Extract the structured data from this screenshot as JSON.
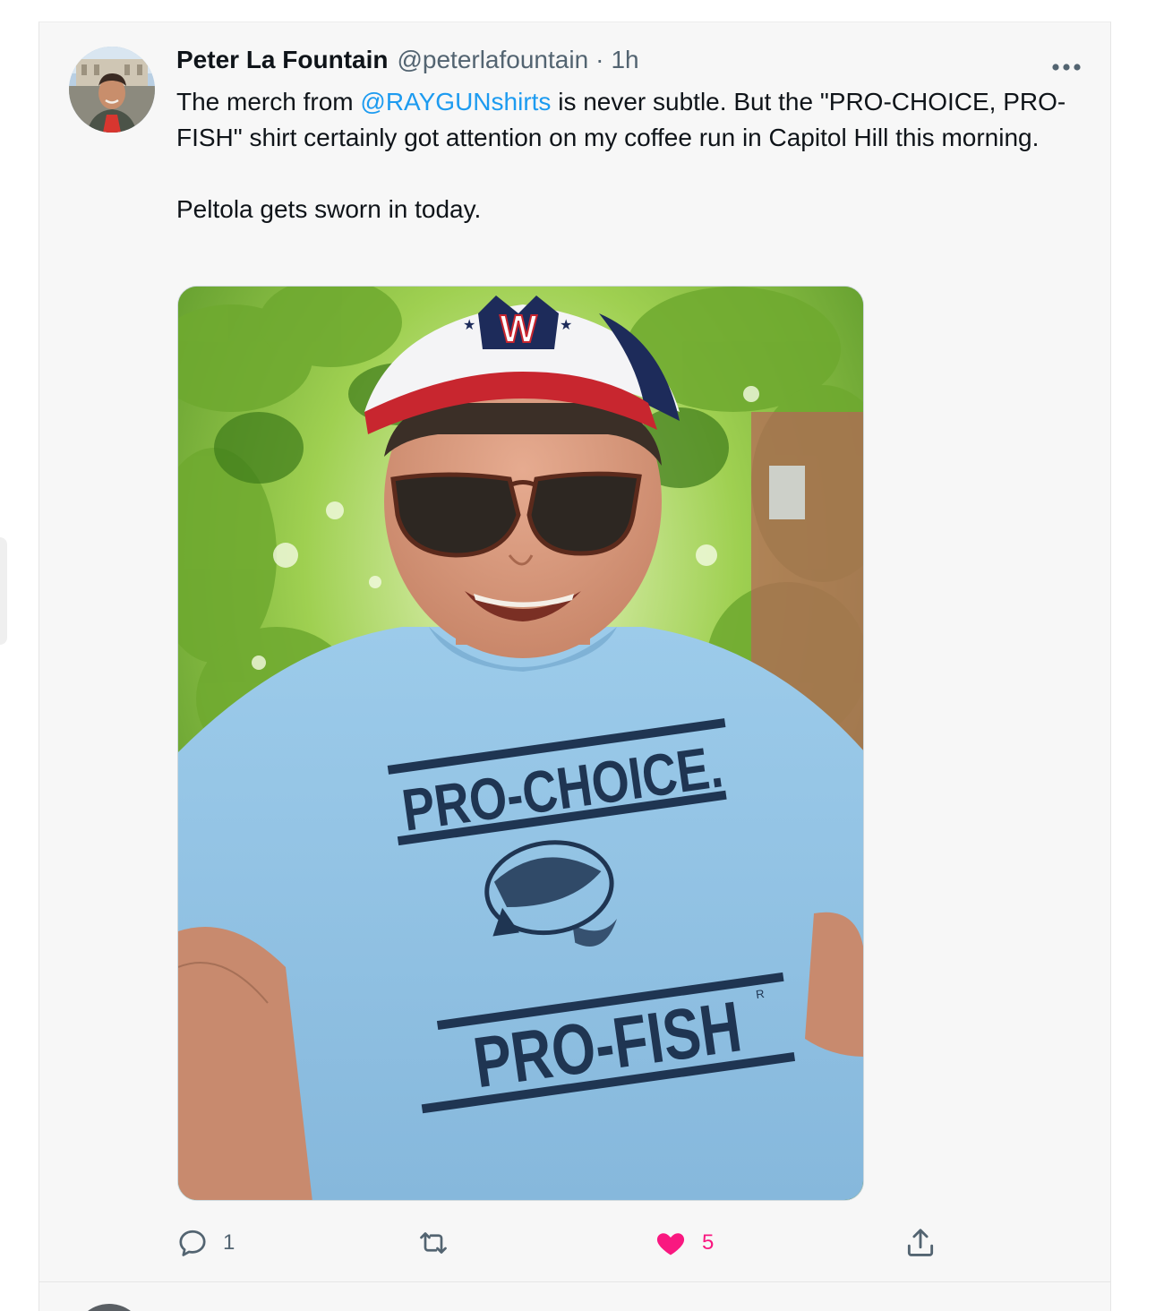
{
  "tweet": {
    "author": {
      "display_name": "Peter La Fountain",
      "handle": "@peterlafountain"
    },
    "separator": "·",
    "time": "1h",
    "text": {
      "prefix": "The merch from ",
      "mention": "@RAYGUNshirts",
      "suffix": " is never subtle. But the \"PRO-CHOICE, PRO-FISH\" shirt certainly got attention on my coffee run in Capitol Hill this morning.",
      "second_paragraph": "Peltola gets sworn in today."
    },
    "photo": {
      "cap_letter": "W",
      "shirt_line_1": "PRO-CHOICE.",
      "shirt_line_2": "PRO-FISH",
      "shirt_mark": "R"
    },
    "actions": {
      "reply_count": "1",
      "retweet_count": "",
      "like_count": "5"
    },
    "colors": {
      "link": "#1d9bf0",
      "like": "#f91880",
      "muted": "#536471"
    }
  },
  "icons": {
    "more": "more-horizontal-icon",
    "reply": "reply-icon",
    "retweet": "retweet-icon",
    "like": "heart-icon",
    "share": "share-icon"
  }
}
